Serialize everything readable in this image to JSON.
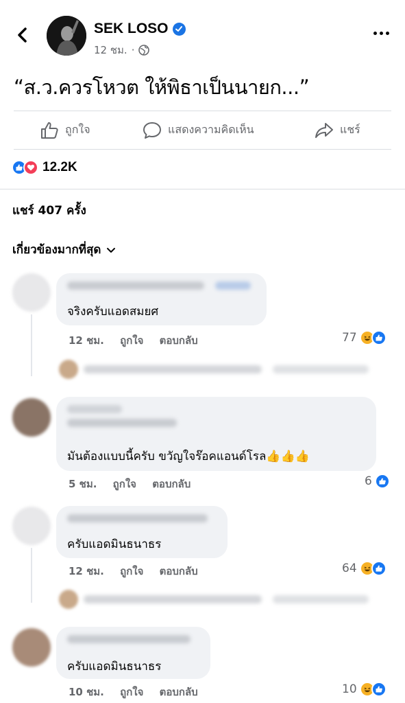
{
  "header": {
    "page_name": "SEK LOSO",
    "time": "12 ชม.",
    "dot": "·"
  },
  "post": {
    "text": "“ส.ว.ควรโหวต ให้พิธาเป็นนายก...”"
  },
  "actions": {
    "like": "ถูกใจ",
    "comment": "แสดงความคิดเห็น",
    "share": "แชร์"
  },
  "reactions": {
    "count": "12.2K"
  },
  "shares_text": "แชร์ 407 ครั้ง",
  "sort_label": "เกี่ยวข้องมากที่สุด",
  "comments": [
    {
      "text": "จริงครับแอดสมยศ",
      "time": "12 ชม.",
      "like": "ถูกใจ",
      "reply": "ตอบกลับ",
      "count": "77"
    },
    {
      "text": "มันต้องแบบนี้ครับ ขวัญใจร๊อคแอนด์โรล👍👍👍",
      "time": "5 ชม.",
      "like": "ถูกใจ",
      "reply": "ตอบกลับ",
      "count": "6"
    },
    {
      "text": "ครับแอดมินธนาธร",
      "time": "12 ชม.",
      "like": "ถูกใจ",
      "reply": "ตอบกลับ",
      "count": "64"
    },
    {
      "text": "ครับแอดมินธนาธร",
      "time": "10 ชม.",
      "like": "ถูกใจ",
      "reply": "ตอบกลับ",
      "count": "10"
    }
  ],
  "icons": {
    "back": "chevron-left-icon",
    "more": "more-horizontal-icon",
    "verified": "verified-badge-icon",
    "globe": "globe-icon",
    "like": "thumbs-up-icon",
    "comment": "speech-bubble-icon",
    "share": "share-arrow-icon"
  },
  "colors": {
    "like_blue": "#1877f2",
    "love_red": "#f33e58",
    "haha_yellow": "#f7b125",
    "secondary_text": "#65676b",
    "bubble_bg": "#f0f2f5"
  }
}
